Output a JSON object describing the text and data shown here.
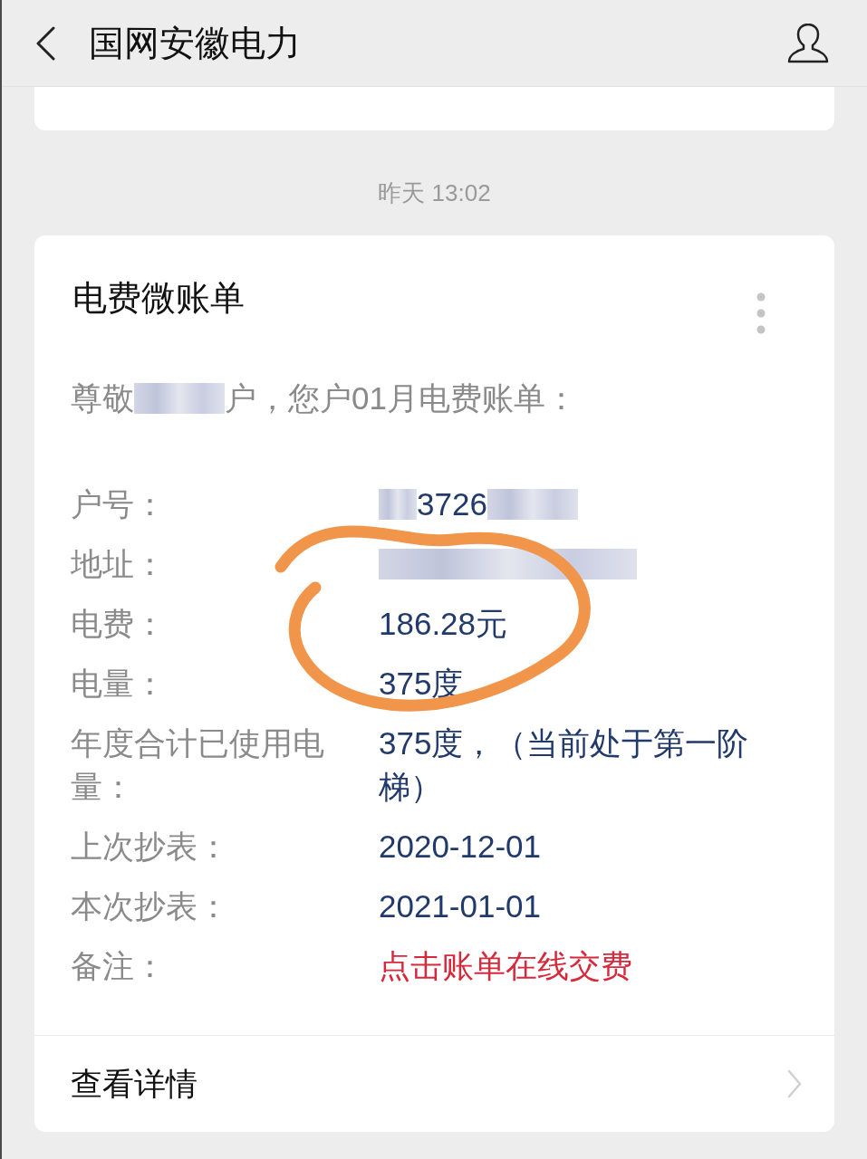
{
  "header": {
    "title": "国网安徽电力"
  },
  "timestamp": "昨天 13:02",
  "bill_card": {
    "title": "电费微账单",
    "greeting": {
      "before": "尊敬",
      "after": "户，您户01月电费账单："
    },
    "rows": [
      {
        "label": "户号：",
        "kind": "partly_redacted",
        "value": "3726"
      },
      {
        "label": "地址：",
        "kind": "redacted"
      },
      {
        "label": "电费：",
        "kind": "text",
        "value": "186.28元"
      },
      {
        "label": "电量：",
        "kind": "text",
        "value": "375度"
      },
      {
        "label": "年度合计已使用电量：",
        "kind": "text",
        "value": "375度，（当前处于第一阶梯）"
      },
      {
        "label": "上次抄表：",
        "kind": "text",
        "value": "2020-12-01"
      },
      {
        "label": "本次抄表：",
        "kind": "text",
        "value": "2021-01-01"
      },
      {
        "label": "备注：",
        "kind": "link",
        "value": "点击账单在线交费"
      }
    ],
    "footer_link": "查看详情"
  }
}
